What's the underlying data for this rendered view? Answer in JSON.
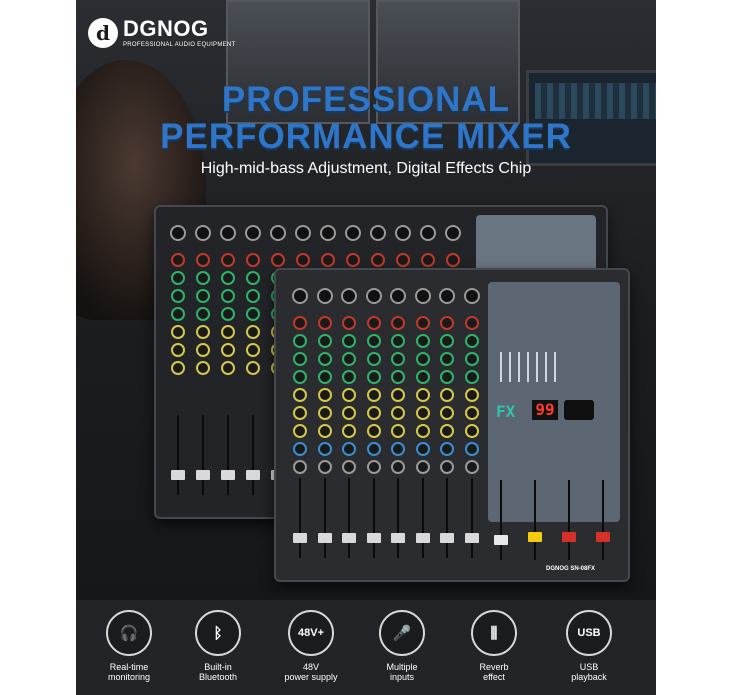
{
  "brand": {
    "logo_letter": "d",
    "name": "DGNOG",
    "tagline": "PROFESSIONAL AUDIO EQUIPMENT"
  },
  "headline": {
    "line1": "PROFESSIONAL",
    "line2": "PERFORMANCE MIXER"
  },
  "subheadline": "High-mid-bass Adjustment, Digital Effects Chip",
  "mixer_front": {
    "fx_label": "FX",
    "display_value": "99",
    "plate": "DGNOG  SN-08FX"
  },
  "features": [
    {
      "line1": "Real-time",
      "line2": "monitoring",
      "icon": "headphones-icon",
      "glyph": "🎧"
    },
    {
      "line1": "Built-in",
      "line2": "Bluetooth",
      "icon": "bluetooth-icon",
      "glyph": "ᛒ"
    },
    {
      "line1": "48V",
      "line2": "power supply",
      "icon": "phantom-power-icon",
      "glyph": "48V+"
    },
    {
      "line1": "Multiple",
      "line2": "inputs",
      "icon": "microphone-icon",
      "glyph": "🎤"
    },
    {
      "line1": "Reverb",
      "line2": "effect",
      "icon": "faders-icon",
      "glyph": "⫼"
    },
    {
      "line1": "USB",
      "line2": "playback",
      "icon": "usb-icon",
      "glyph": "USB"
    }
  ]
}
